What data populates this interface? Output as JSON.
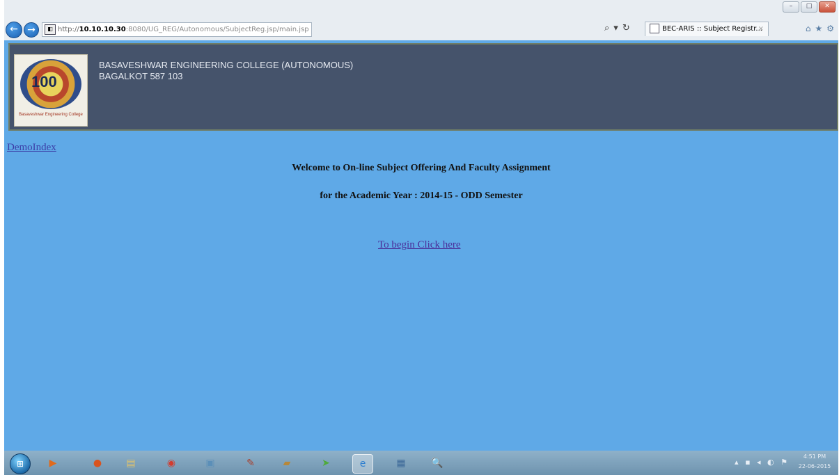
{
  "browser": {
    "url_scheme": "http://",
    "url_host": "10.10.10.30",
    "url_rest": ":8080/UG_REG/Autonomous/SubjectReg.jsp/main.jsp",
    "search_glyph": "⌕",
    "dropdown_glyph": "▾",
    "refresh_glyph": "↻",
    "tab_title": "BEC-ARIS :: Subject Registr...",
    "tab_close": "×",
    "back_glyph": "←",
    "forward_glyph": "→",
    "home_glyph": "⌂",
    "favorites_glyph": "★",
    "tools_glyph": "⚙",
    "min_glyph": "–",
    "max_glyph": "□",
    "close_glyph": "✕"
  },
  "header": {
    "college_line1": "BASAVESHWAR ENGINEERING COLLEGE (AUTONOMOUS)",
    "college_line2": "BAGALKOT 587 103",
    "logo_number": "100",
    "logo_caption": "Basaveshwar Engineering College"
  },
  "page": {
    "demo_link": "DemoIndex",
    "welcome": "Welcome to On-line Subject Offering And Faculty Assignment",
    "academic_year": "for the Academic Year : 2014-15 - ODD Semester",
    "begin_link": "To begin Click here"
  },
  "taskbar": {
    "start_glyph": "⊞",
    "apps": [
      {
        "name": "media-player-icon",
        "glyph": "▶",
        "color": "#e06a1c"
      },
      {
        "name": "firefox-icon",
        "glyph": "●",
        "color": "#d9531e"
      },
      {
        "name": "file-explorer-icon",
        "glyph": "▤",
        "color": "#e2c36a"
      },
      {
        "name": "chrome-icon",
        "glyph": "◉",
        "color": "#d23c2f"
      },
      {
        "name": "remote-desktop-icon",
        "glyph": "▣",
        "color": "#5b8fb8"
      },
      {
        "name": "paint-icon",
        "glyph": "✎",
        "color": "#a8402f"
      },
      {
        "name": "folder-tool-icon",
        "glyph": "▰",
        "color": "#b7883a"
      },
      {
        "name": "arrow-app-icon",
        "glyph": "➤",
        "color": "#4faa3a"
      },
      {
        "name": "internet-explorer-icon",
        "glyph": "e",
        "color": "#2e7fd0"
      },
      {
        "name": "window-app-icon",
        "glyph": "▦",
        "color": "#3e6a99"
      },
      {
        "name": "magnifier-icon",
        "glyph": "🔍",
        "color": "#445566"
      }
    ],
    "tray_glyphs": "▴ ▪ ◂ ◐ ⚑",
    "time": "4:51 PM",
    "date": "22-06-2015"
  }
}
